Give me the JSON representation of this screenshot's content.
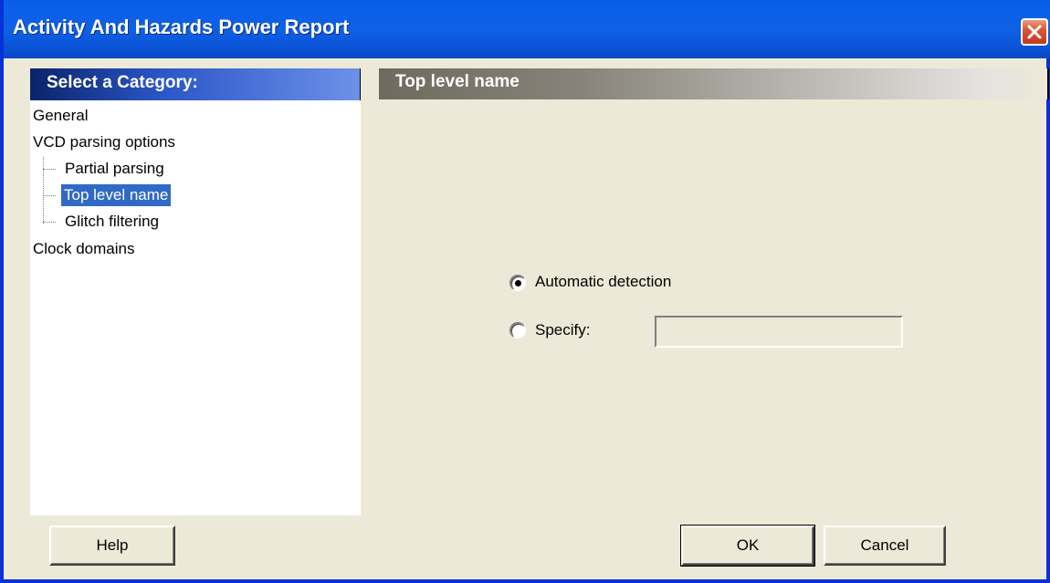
{
  "window": {
    "title": "Activity And Hazards Power Report"
  },
  "categories": {
    "header": "Select a Category:",
    "items": [
      {
        "label": "General"
      },
      {
        "label": "VCD parsing options"
      },
      {
        "label": "Partial parsing"
      },
      {
        "label": "Top level name"
      },
      {
        "label": "Glitch filtering"
      },
      {
        "label": "Clock domains"
      }
    ],
    "selected": "Top level name"
  },
  "section": {
    "header": "Top level name",
    "options": [
      {
        "label": "Automatic detection",
        "checked": true
      },
      {
        "label": "Specify:",
        "checked": false
      }
    ],
    "specify_value": ""
  },
  "buttons": {
    "help": "Help",
    "ok": "OK",
    "cancel": "Cancel"
  },
  "icons": {
    "close": "close-icon",
    "radio": "radio-icon"
  },
  "colors": {
    "titlebar": "#0a5ae6",
    "selection": "#316ac5",
    "dialog_bg": "#ece9d8",
    "close": "#d8563a"
  }
}
